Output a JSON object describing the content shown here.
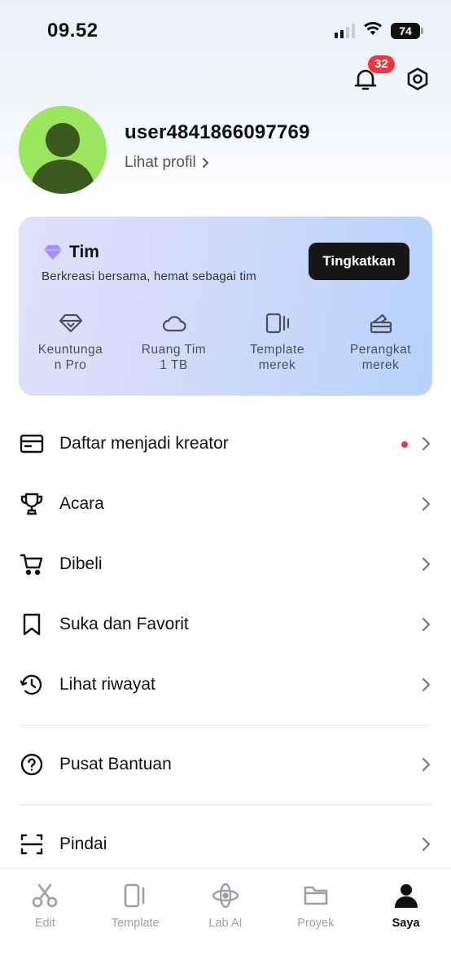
{
  "status_bar": {
    "time": "09.52",
    "battery": "74"
  },
  "header": {
    "notification_count": "32"
  },
  "profile": {
    "username": "user4841866097769",
    "view_profile_label": "Lihat profil"
  },
  "team_card": {
    "title": "Tim",
    "subtitle": "Berkreasi bersama, hemat sebagai tim",
    "upgrade_label": "Tingkatkan",
    "features": [
      {
        "label": "Keuntunga\nn Pro",
        "icon": "diamond-icon"
      },
      {
        "label": "Ruang Tim\n1 TB",
        "icon": "cloud-icon"
      },
      {
        "label": "Template\nmerek",
        "icon": "template-icon"
      },
      {
        "label": "Perangkat\nmerek",
        "icon": "brand-kit-icon"
      }
    ]
  },
  "menu": {
    "items": [
      {
        "label": "Daftar menjadi kreator",
        "icon": "card-icon"
      },
      {
        "label": "Acara",
        "icon": "trophy-icon"
      },
      {
        "label": "Dibeli",
        "icon": "cart-icon"
      },
      {
        "label": "Suka dan Favorit",
        "icon": "bookmark-icon"
      },
      {
        "label": "Lihat riwayat",
        "icon": "history-icon"
      },
      {
        "label": "Pusat Bantuan",
        "icon": "help-icon"
      },
      {
        "label": "Pindai",
        "icon": "scan-icon"
      }
    ]
  },
  "tab_bar": {
    "tabs": [
      {
        "label": "Edit",
        "icon": "scissors-icon"
      },
      {
        "label": "Template",
        "icon": "template-icon"
      },
      {
        "label": "Lab AI",
        "icon": "ai-lab-icon"
      },
      {
        "label": "Proyek",
        "icon": "folder-icon"
      },
      {
        "label": "Saya",
        "icon": "person-icon"
      }
    ],
    "active": "Saya"
  },
  "colors": {
    "accent_red": "#f5333f",
    "avatar_bg": "#9ae65e",
    "avatar_fg": "#3a5a1f",
    "button_dark": "#161616",
    "tim_icon": "#a78bfa"
  }
}
